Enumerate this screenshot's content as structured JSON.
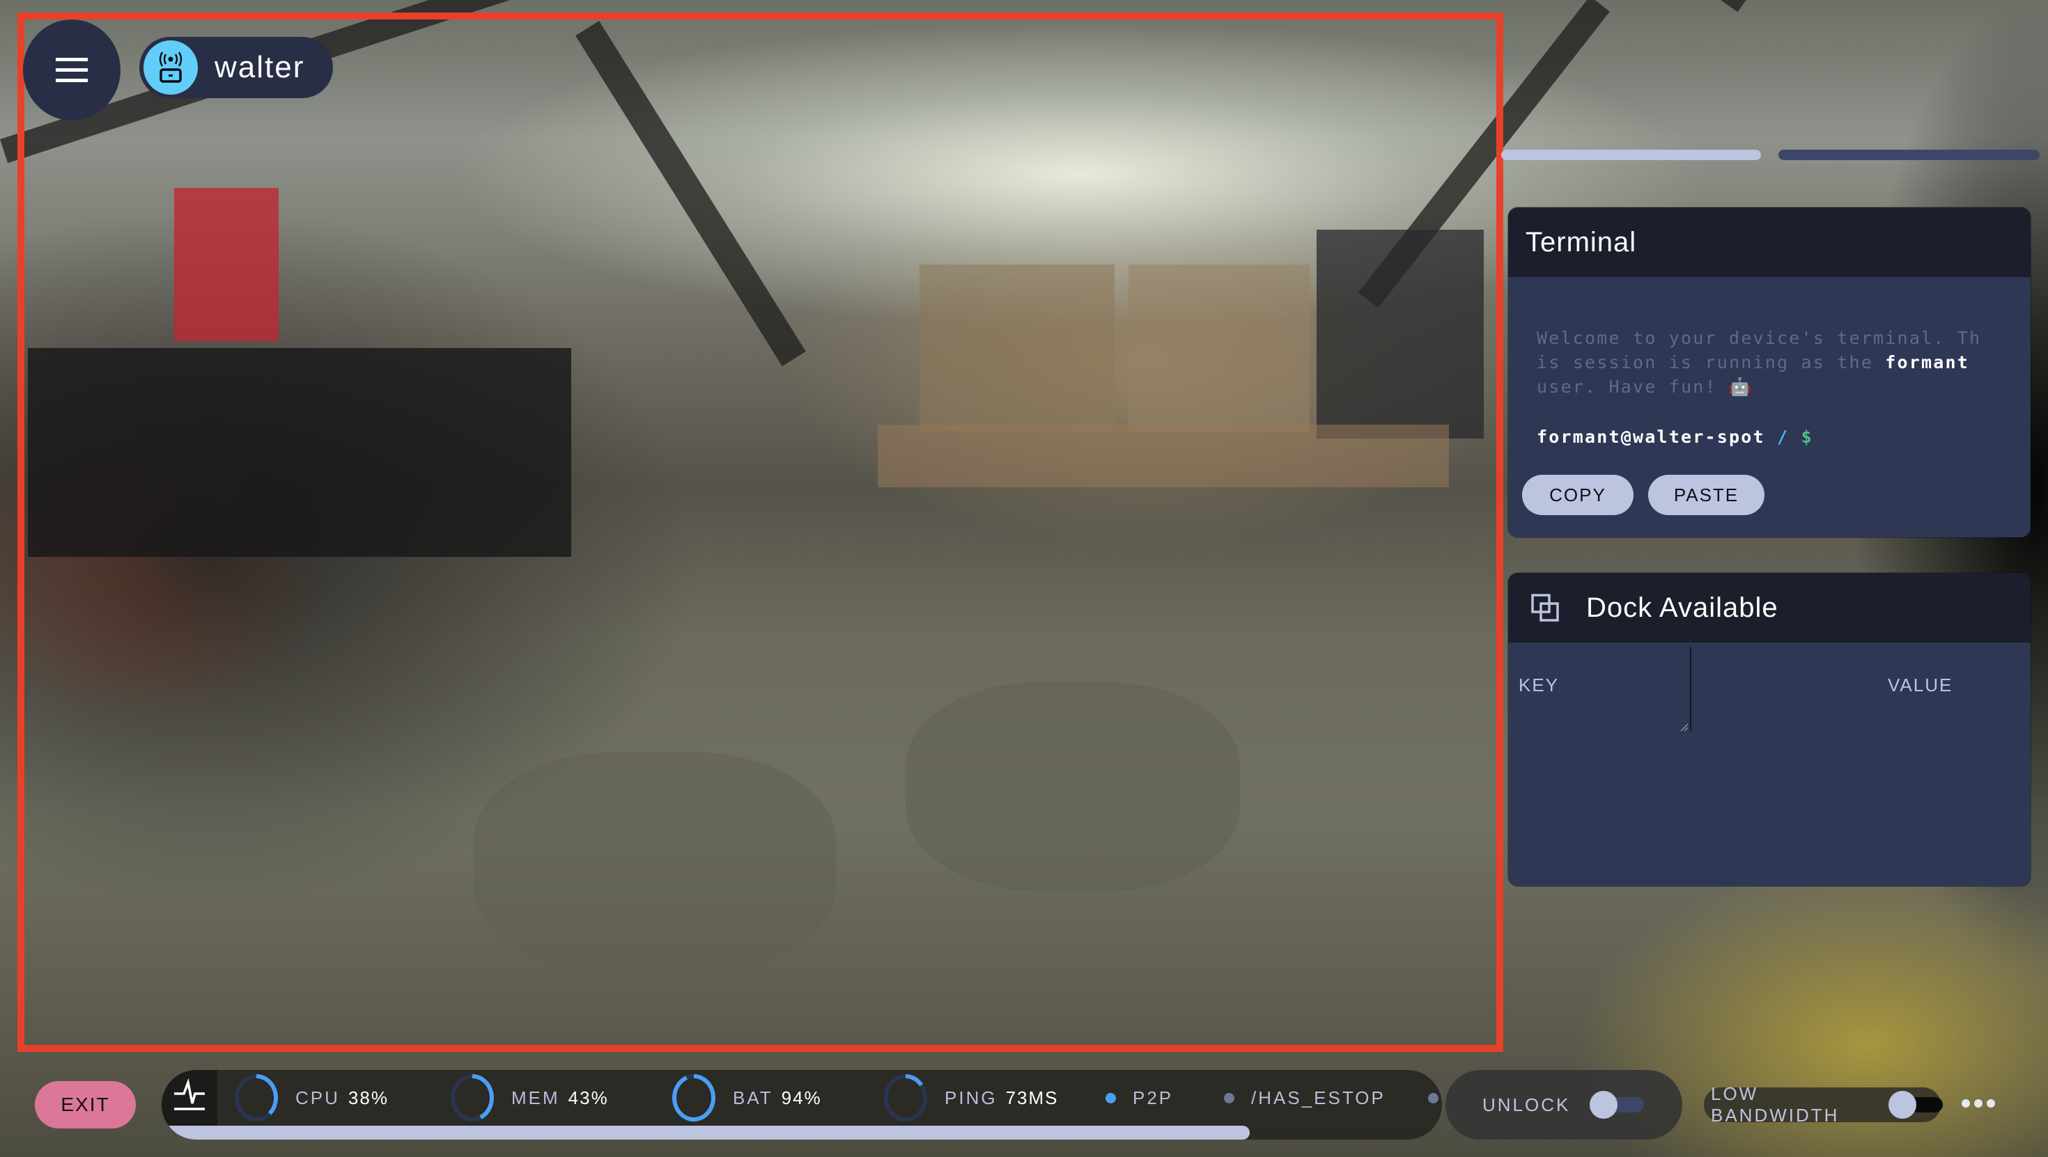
{
  "device": {
    "name": "walter",
    "icon": "robot-signal-icon"
  },
  "menu": {
    "icon": "hamburger-menu-icon"
  },
  "page_indicator": {
    "count": 2,
    "active_index": 0,
    "colors": {
      "active": "#bcc4e0",
      "inactive": "#3c4668"
    }
  },
  "terminal": {
    "title": "Terminal",
    "welcome_pre": "Welcome to your device's terminal. Th is session is running as the ",
    "welcome_line1": "Welcome to your device's terminal. Th",
    "welcome_line2_pre": "is session is running as the ",
    "welcome_user": "formant",
    "welcome_line3": "user. Have fun! 🤖",
    "prompt_user_host": "formant@walter-spot",
    "prompt_path": "/",
    "prompt_symbol": "$",
    "copy_label": "COPY",
    "paste_label": "PASTE"
  },
  "dock": {
    "title": "Dock Available",
    "icon": "copy-squares-icon",
    "columns": {
      "key": "KEY",
      "value": "VALUE"
    },
    "rows": []
  },
  "bottom_bar": {
    "exit_label": "EXIT",
    "heartbeat_icon": "heartbeat-icon",
    "metrics": [
      {
        "label": "CPU",
        "value": "38%",
        "fraction": 0.38
      },
      {
        "label": "MEM",
        "value": "43%",
        "fraction": 0.43
      },
      {
        "label": "BAT",
        "value": "94%",
        "fraction": 0.94
      },
      {
        "label": "PING",
        "value": "73MS",
        "fraction": 0.15
      }
    ],
    "indicators": [
      {
        "label": "P2P",
        "color": "#4a9ff5"
      },
      {
        "label": "/HAS_ESTOP",
        "color": "#6e7899"
      }
    ],
    "strip_scroll_fraction": 0.85,
    "unlock": {
      "label": "UNLOCK",
      "on": false
    },
    "low_bandwidth": {
      "label": "LOW BANDWIDTH",
      "on": false
    },
    "more_icon": "more-horizontal-icon"
  },
  "colors": {
    "selection_frame": "#e8412a",
    "panel_header": "#1c1e2b",
    "panel_body": "#2e3753",
    "accent_blue": "#4a9ff5",
    "exit": "#dd7799",
    "button_light": "#bcc4e0",
    "ring_track": "#2a3452"
  }
}
